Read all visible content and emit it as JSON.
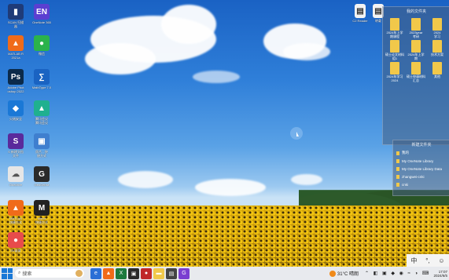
{
  "desktop_icons": [
    {
      "id": "scan",
      "label": "SCAN 扫描\n器",
      "color": "#1f3b78",
      "glyph": "▮"
    },
    {
      "id": "onenote",
      "label": "OneNote 365",
      "color": "#5b3fd1",
      "glyph": "EN"
    },
    {
      "id": "matlab1",
      "label": "MATLAB R\n2021a",
      "color": "#f06b1a",
      "glyph": "▲"
    },
    {
      "id": "wechat",
      "label": "微信",
      "color": "#2bb34b",
      "glyph": "●"
    },
    {
      "id": "ps",
      "label": "Adobe Phot\noshop 2022",
      "color": "#0b2a4a",
      "glyph": "Ps"
    },
    {
      "id": "mathtype",
      "label": "MathType 7.0",
      "color": "#1a63c2",
      "glyph": "∑"
    },
    {
      "id": "defender",
      "label": "火绒安全",
      "color": "#1a78d6",
      "glyph": "◆"
    },
    {
      "id": "tencent",
      "label": "腾讯会议\n腾讯会议",
      "color": "#1fb08f",
      "glyph": "▲"
    },
    {
      "id": "sapp",
      "label": "S 新建文档\n文件",
      "color": "#5a2a9c",
      "glyph": "S"
    },
    {
      "id": "photos",
      "label": "照片 - 快\n捷方式",
      "color": "#3f7fcf",
      "glyph": "▣"
    },
    {
      "id": "cloud",
      "label": "Onedrive",
      "color": "#e6e6e6",
      "glyph": "☁"
    },
    {
      "id": "gapp",
      "label": "GeoGebra",
      "color": "#2a2a2a",
      "glyph": "G"
    },
    {
      "id": "matlab2",
      "label": "MATLAB\n快捷方式",
      "color": "#f06b1a",
      "glyph": "▲"
    },
    {
      "id": "mirror",
      "label": "Mirror\n快捷方式",
      "color": "#222222",
      "glyph": "M"
    },
    {
      "id": "ev",
      "label": "EV录屏",
      "color": "#e84b4b",
      "glyph": "●"
    }
  ],
  "top_right_icons": [
    {
      "id": "chrome-folder",
      "label": "C2 Reader"
    },
    {
      "id": "doc-file",
      "label": "转载"
    }
  ],
  "folder_panel": {
    "title": "我的文件夹",
    "items": [
      {
        "label": "2024年上学\n期课程"
      },
      {
        "label": "2023year\n考研"
      },
      {
        "label": "2024\n学习"
      },
      {
        "label": "硕士论文材料\n组1"
      },
      {
        "label": "2024年上学\n期"
      },
      {
        "label": "技术方案"
      },
      {
        "label": "2024年学习\n2024"
      },
      {
        "label": "硕士申请材料\n汇总"
      },
      {
        "label": "其他"
      }
    ]
  },
  "quick_panel": {
    "title": "新建文件夹",
    "items": [
      {
        "label": "我的"
      },
      {
        "label": "My OneNote Library"
      },
      {
        "label": "My OneNote Library Data"
      },
      {
        "label": "zhangwei-cnki"
      },
      {
        "label": "cnki"
      }
    ]
  },
  "ime": {
    "zh": "中",
    "punct": "°,",
    "emoji": "☺"
  },
  "taskbar": {
    "search_placeholder": "搜索",
    "weather": "31°C 晴朗",
    "time": "17:07",
    "date": "2024/6/5"
  },
  "colors": {
    "taskbar": "#e8eaee",
    "accent": "#1a63c2"
  }
}
